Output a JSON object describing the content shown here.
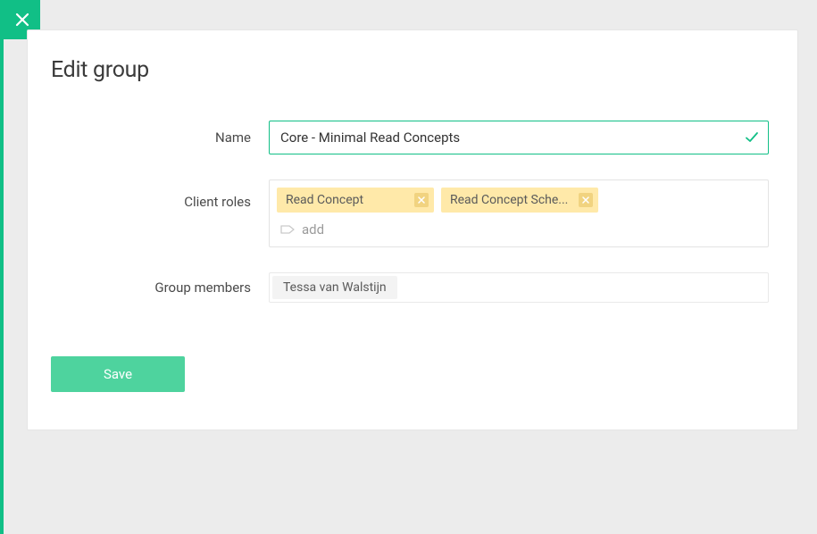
{
  "header": {
    "title": "Edit group"
  },
  "form": {
    "name": {
      "label": "Name",
      "value": "Core - Minimal Read Concepts"
    },
    "clientRoles": {
      "label": "Client roles",
      "tags": [
        "Read Concept",
        "Read Concept Sche..."
      ],
      "addPlaceholder": "add"
    },
    "groupMembers": {
      "label": "Group members",
      "members": [
        "Tessa van Walstijn"
      ]
    }
  },
  "actions": {
    "save": "Save"
  }
}
